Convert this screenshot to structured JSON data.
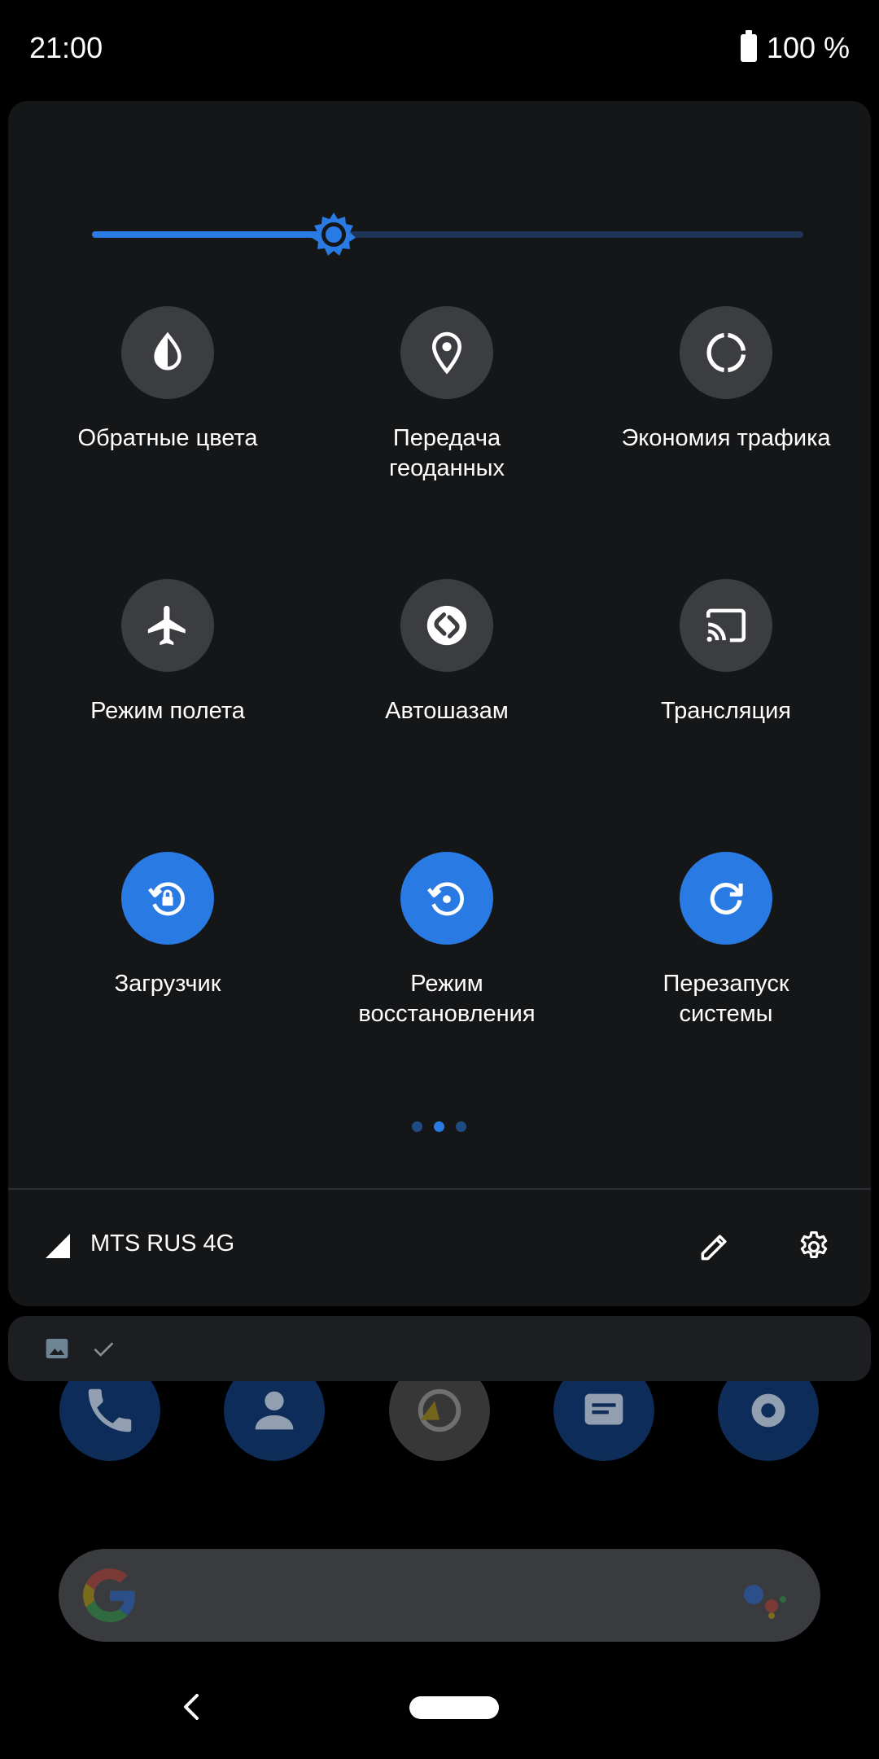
{
  "status_bar": {
    "time": "21:00",
    "battery_text": "100 %",
    "battery_icon": "battery-full-icon"
  },
  "brightness": {
    "level_fraction": 0.34,
    "icon": "brightness-icon"
  },
  "tiles": [
    {
      "label": "Обратные цвета",
      "icon": "invert-colors-icon",
      "active": false
    },
    {
      "label": "Передача\nгеоданных",
      "icon": "location-icon",
      "active": false
    },
    {
      "label": "Экономия трафика",
      "icon": "data-saver-icon",
      "active": false
    },
    {
      "label": "Режим полета",
      "icon": "airplane-icon",
      "active": false
    },
    {
      "label": "Автошазам",
      "icon": "shazam-icon",
      "active": false
    },
    {
      "label": "Трансляция",
      "icon": "cast-icon",
      "active": false
    },
    {
      "label": "Загрузчик",
      "icon": "bootloader-icon",
      "active": true
    },
    {
      "label": "Режим\nвосстановления",
      "icon": "recovery-icon",
      "active": true
    },
    {
      "label": "Перезапуск\nсистемы",
      "icon": "restart-icon",
      "active": true
    }
  ],
  "pagination": {
    "total": 3,
    "current": 2
  },
  "footer": {
    "carrier": "MTS RUS 4G",
    "signal_icon": "signal-icon",
    "edit_icon": "edit-icon",
    "settings_icon": "settings-icon"
  },
  "notification": {
    "icons": [
      "image-icon",
      "check-icon"
    ]
  },
  "colors": {
    "accent": "#2a7ae4",
    "panel": "#151618",
    "tile_inactive": "#3c3d40",
    "track": "#1d3557"
  }
}
